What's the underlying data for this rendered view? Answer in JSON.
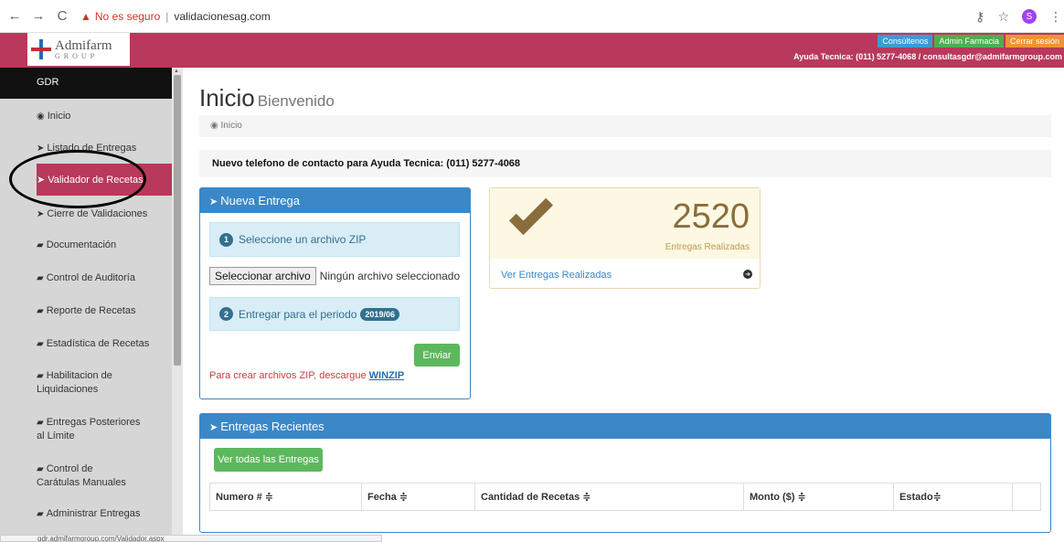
{
  "browser": {
    "back": "←",
    "forward": "→",
    "reload": "C",
    "security": "No es seguro",
    "url": "validacionesag.com",
    "profile_initial": "S"
  },
  "header": {
    "logo_name": "Admifarm",
    "logo_group": "GROUP",
    "buttons": [
      "Consúltenos",
      "Admin Farmacia",
      "Cerrar sesión"
    ],
    "help": "Ayuda Tecnica: (011) 5277-4068 / consultasgdr@admifarmgroup.com"
  },
  "sidebar": {
    "title": "GDR",
    "items": [
      "Inicio",
      "Listado de Entregas",
      "Validador de Recetas",
      "Cierre de Validaciones",
      "Documentación",
      "Control de Auditoría",
      "Reporte de Recetas",
      "Estadística de Recetas",
      "Habilitacion de Liquidaciones",
      "Entregas Posteriores al Límite",
      "Control de Carátulas Manuales",
      "Administrar Entregas"
    ]
  },
  "main": {
    "title": "Inicio",
    "subtitle": "Bienvenido",
    "breadcrumb": "Inicio",
    "notice": "Nuevo telefono de contacto para Ayuda Tecnica: (011) 5277-4068",
    "nueva_entrega": {
      "heading": "Nueva Entrega",
      "step1_num": "1",
      "step1": "Seleccione un archivo ZIP",
      "file_button": "Seleccionar archivo",
      "file_status": "Ningún archivo seleccionado",
      "step2_num": "2",
      "step2": "Entregar para el periodo",
      "period": "2019/06",
      "send": "Enviar",
      "zip_note": "Para crear archivos ZIP, descargue",
      "zip_link": "WINZIP"
    },
    "stats": {
      "count": "2520",
      "label": "Entregas Realizadas",
      "link": "Ver Entregas Realizadas"
    },
    "recientes": {
      "heading": "Entregas Recientes",
      "button": "Ver todas las Entregas",
      "columns": [
        "Numero # ≑",
        "Fecha ≑",
        "Cantidad de Recetas ≑",
        "Monto ($) ≑",
        "Estado≑"
      ]
    }
  },
  "status_url": "gdr.admifarmgroup.com/Validador.aspx"
}
